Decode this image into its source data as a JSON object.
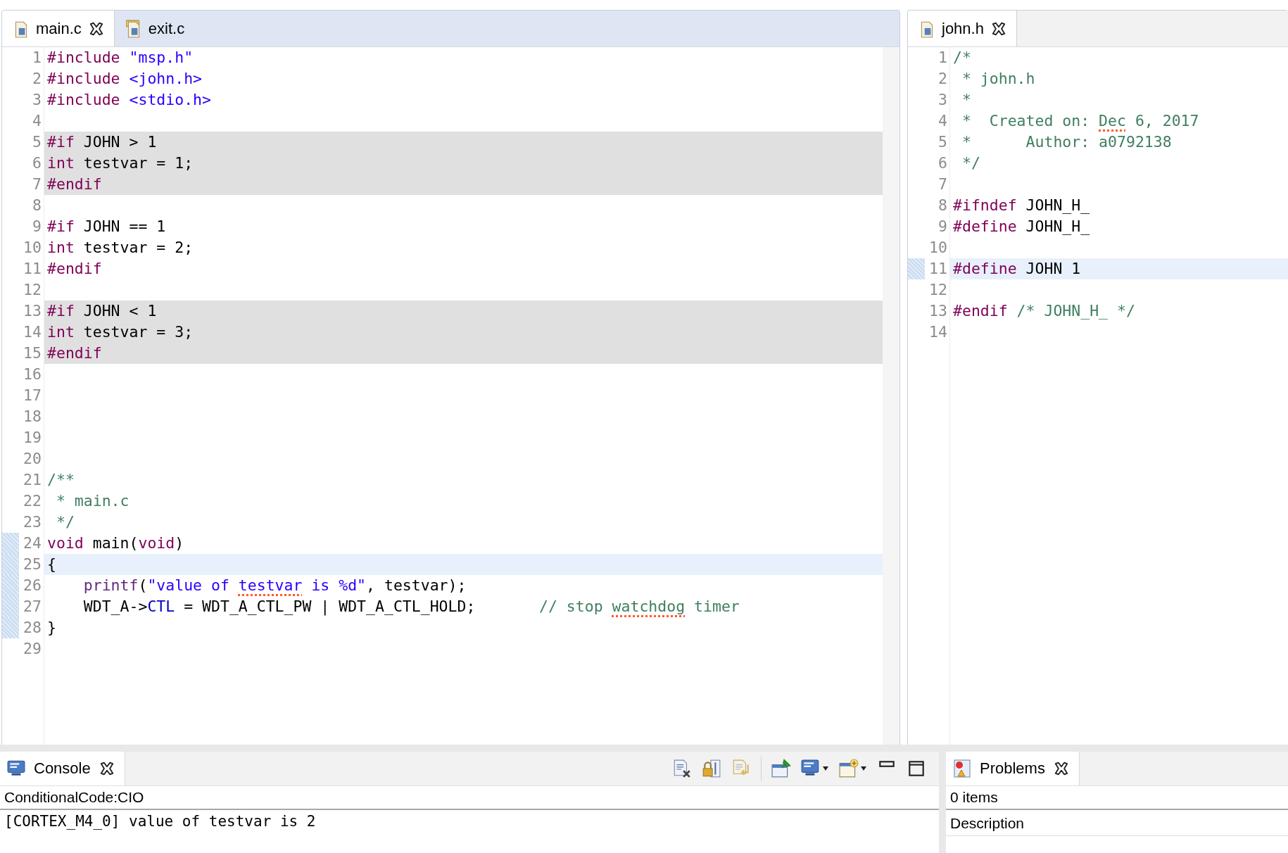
{
  "editors": [
    {
      "tabs": [
        {
          "label": "main.c",
          "selected": true,
          "closable": true,
          "kind": "c"
        },
        {
          "label": "exit.c",
          "selected": false,
          "closable": false,
          "kind": "c-folder"
        }
      ],
      "lines": [
        {
          "number": "1",
          "kind": "normal",
          "marked": false,
          "spans": [
            {
              "kind": "pp",
              "text": "#include "
            },
            {
              "kind": "str",
              "text": "\"msp.h\""
            }
          ]
        },
        {
          "number": "2",
          "kind": "normal",
          "marked": false,
          "spans": [
            {
              "kind": "pp",
              "text": "#include "
            },
            {
              "kind": "str",
              "text": "<john.h>"
            }
          ]
        },
        {
          "number": "3",
          "kind": "normal",
          "marked": false,
          "spans": [
            {
              "kind": "pp",
              "text": "#include "
            },
            {
              "kind": "str",
              "text": "<stdio.h>"
            }
          ]
        },
        {
          "number": "4",
          "kind": "normal",
          "marked": false
        },
        {
          "number": "5",
          "kind": "inactive",
          "marked": false,
          "spans": [
            {
              "kind": "pp",
              "text": "#if"
            },
            {
              "kind": "plain",
              "text": " JOHN > 1"
            }
          ]
        },
        {
          "number": "6",
          "kind": "inactive",
          "marked": false,
          "spans": [
            {
              "kind": "kw",
              "text": "int"
            },
            {
              "kind": "plain",
              "text": " testvar = 1;"
            }
          ]
        },
        {
          "number": "7",
          "kind": "inactive",
          "marked": false,
          "spans": [
            {
              "kind": "pp",
              "text": "#endif"
            }
          ]
        },
        {
          "number": "8",
          "kind": "normal",
          "marked": false
        },
        {
          "number": "9",
          "kind": "normal",
          "marked": false,
          "spans": [
            {
              "kind": "pp",
              "text": "#if"
            },
            {
              "kind": "plain",
              "text": " JOHN == 1"
            }
          ]
        },
        {
          "number": "10",
          "kind": "normal",
          "marked": false,
          "spans": [
            {
              "kind": "kw",
              "text": "int"
            },
            {
              "kind": "plain",
              "text": " testvar = 2;"
            }
          ]
        },
        {
          "number": "11",
          "kind": "normal",
          "marked": false,
          "spans": [
            {
              "kind": "pp",
              "text": "#endif"
            }
          ]
        },
        {
          "number": "12",
          "kind": "normal",
          "marked": false
        },
        {
          "number": "13",
          "kind": "inactive",
          "marked": false,
          "spans": [
            {
              "kind": "pp",
              "text": "#if"
            },
            {
              "kind": "plain",
              "text": " JOHN < 1"
            }
          ]
        },
        {
          "number": "14",
          "kind": "inactive",
          "marked": false,
          "spans": [
            {
              "kind": "kw",
              "text": "int"
            },
            {
              "kind": "plain",
              "text": " testvar = 3;"
            }
          ]
        },
        {
          "number": "15",
          "kind": "inactive",
          "marked": false,
          "spans": [
            {
              "kind": "pp",
              "text": "#endif"
            }
          ]
        },
        {
          "number": "16",
          "kind": "normal",
          "marked": false
        },
        {
          "number": "17",
          "kind": "normal",
          "marked": false
        },
        {
          "number": "18",
          "kind": "normal",
          "marked": false
        },
        {
          "number": "19",
          "kind": "normal",
          "marked": false
        },
        {
          "number": "20",
          "kind": "normal",
          "marked": false
        },
        {
          "number": "21",
          "kind": "normal",
          "marked": false,
          "spans": [
            {
              "kind": "cmt",
              "text": "/**"
            }
          ]
        },
        {
          "number": "22",
          "kind": "normal",
          "marked": false,
          "spans": [
            {
              "kind": "cmt",
              "text": " * main.c"
            }
          ]
        },
        {
          "number": "23",
          "kind": "normal",
          "marked": false,
          "spans": [
            {
              "kind": "cmt",
              "text": " */"
            }
          ]
        },
        {
          "number": "24",
          "kind": "normal",
          "marked": true,
          "spans": [
            {
              "kind": "kw",
              "text": "void"
            },
            {
              "kind": "plain",
              "text": " main("
            },
            {
              "kind": "kw",
              "text": "void"
            },
            {
              "kind": "plain",
              "text": ")"
            }
          ]
        },
        {
          "number": "25",
          "kind": "current",
          "marked": true,
          "spans": [
            {
              "kind": "plain",
              "text": "{"
            }
          ]
        },
        {
          "number": "26",
          "kind": "normal",
          "marked": true,
          "spans": [
            {
              "kind": "indented-fn",
              "text": "printf"
            },
            {
              "kind": "plain",
              "text": "("
            },
            {
              "kind": "str",
              "text": "\"value of "
            },
            {
              "kind": "str-typo",
              "text": "testvar"
            },
            {
              "kind": "str",
              "text": " is %d\""
            },
            {
              "kind": "plain",
              "text": ", testvar);"
            }
          ]
        },
        {
          "number": "27",
          "kind": "normal",
          "marked": true,
          "spans": [
            {
              "kind": "plain",
              "text": "    WDT_A->"
            },
            {
              "kind": "field",
              "text": "CTL"
            },
            {
              "kind": "plain",
              "text": " = WDT_A_CTL_PW | WDT_A_CTL_HOLD;       "
            },
            {
              "kind": "cmt",
              "text": "// stop "
            },
            {
              "kind": "cmt-typo",
              "text": "watchdog"
            },
            {
              "kind": "cmt",
              "text": " timer"
            }
          ]
        },
        {
          "number": "28",
          "kind": "normal",
          "marked": true,
          "spans": [
            {
              "kind": "plain",
              "text": "}"
            }
          ]
        },
        {
          "number": "29",
          "kind": "normal",
          "marked": false
        }
      ]
    },
    {
      "tabs": [
        {
          "label": "john.h",
          "selected": true,
          "closable": true,
          "kind": "h"
        }
      ],
      "lines": [
        {
          "number": "1",
          "kind": "normal",
          "marked": false,
          "spans": [
            {
              "kind": "cmt",
              "text": "/*"
            }
          ]
        },
        {
          "number": "2",
          "kind": "normal",
          "marked": false,
          "spans": [
            {
              "kind": "cmt",
              "text": " * john.h"
            }
          ]
        },
        {
          "number": "3",
          "kind": "normal",
          "marked": false,
          "spans": [
            {
              "kind": "cmt",
              "text": " *"
            }
          ]
        },
        {
          "number": "4",
          "kind": "normal",
          "marked": false,
          "spans": [
            {
              "kind": "cmt",
              "text": " *  Created on: "
            },
            {
              "kind": "cmt-typo",
              "text": "Dec"
            },
            {
              "kind": "cmt",
              "text": " 6, 2017"
            }
          ]
        },
        {
          "number": "5",
          "kind": "normal",
          "marked": false,
          "spans": [
            {
              "kind": "cmt",
              "text": " *      Author: a0792138"
            }
          ]
        },
        {
          "number": "6",
          "kind": "normal",
          "marked": false,
          "spans": [
            {
              "kind": "cmt",
              "text": " */"
            }
          ]
        },
        {
          "number": "7",
          "kind": "normal",
          "marked": false
        },
        {
          "number": "8",
          "kind": "normal",
          "marked": false,
          "spans": [
            {
              "kind": "pp",
              "text": "#ifndef"
            },
            {
              "kind": "plain",
              "text": " JOHN_H_"
            }
          ]
        },
        {
          "number": "9",
          "kind": "normal",
          "marked": false,
          "spans": [
            {
              "kind": "pp",
              "text": "#define"
            },
            {
              "kind": "plain",
              "text": " JOHN_H_"
            }
          ]
        },
        {
          "number": "10",
          "kind": "normal",
          "marked": false
        },
        {
          "number": "11",
          "kind": "current",
          "marked": true,
          "spans": [
            {
              "kind": "pp",
              "text": "#define"
            },
            {
              "kind": "plain",
              "text": " JOHN 1"
            }
          ]
        },
        {
          "number": "12",
          "kind": "normal",
          "marked": false
        },
        {
          "number": "13",
          "kind": "normal",
          "marked": false,
          "spans": [
            {
              "kind": "pp",
              "text": "#endif"
            },
            {
              "kind": "cmt",
              "text": " /* JOHN_H_ */"
            }
          ]
        },
        {
          "number": "14",
          "kind": "normal",
          "marked": false
        }
      ]
    }
  ],
  "console": {
    "tab": {
      "label": "Console",
      "selected": true
    },
    "name": "ConditionalCode:CIO",
    "output": "[CORTEX_M4_0] value of testvar is 2"
  },
  "problems": {
    "tab": {
      "label": "Problems",
      "selected": true
    },
    "count": "0 items",
    "columns": [
      "Description"
    ]
  }
}
